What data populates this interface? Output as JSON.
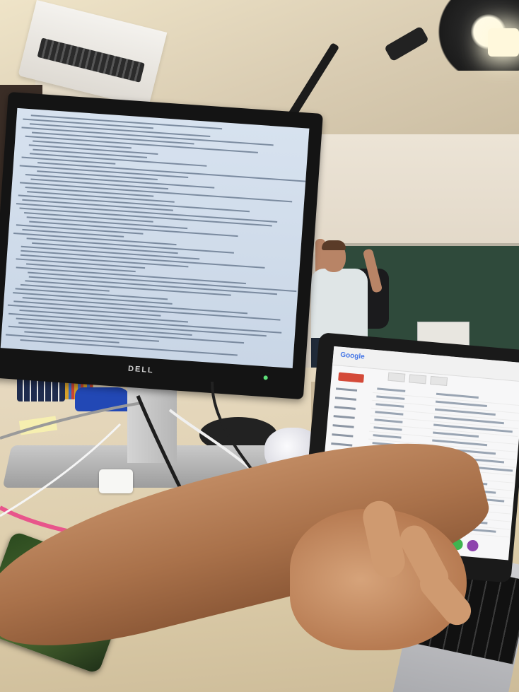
{
  "scene": {
    "monitor_brand": "DELL",
    "laptop_app_logo": "Google",
    "colors": {
      "chalkboard": "#2f4a3b",
      "desk": "#dccca9",
      "monitor_screen": "#cfdbe9",
      "gmail_compose": "#d44a39",
      "power_led": "#5fe07a"
    },
    "dock_icon_colors": [
      "#2e8cf0",
      "#e84c3d",
      "#f2a33a",
      "#3fb34f",
      "#8e44ad"
    ]
  }
}
